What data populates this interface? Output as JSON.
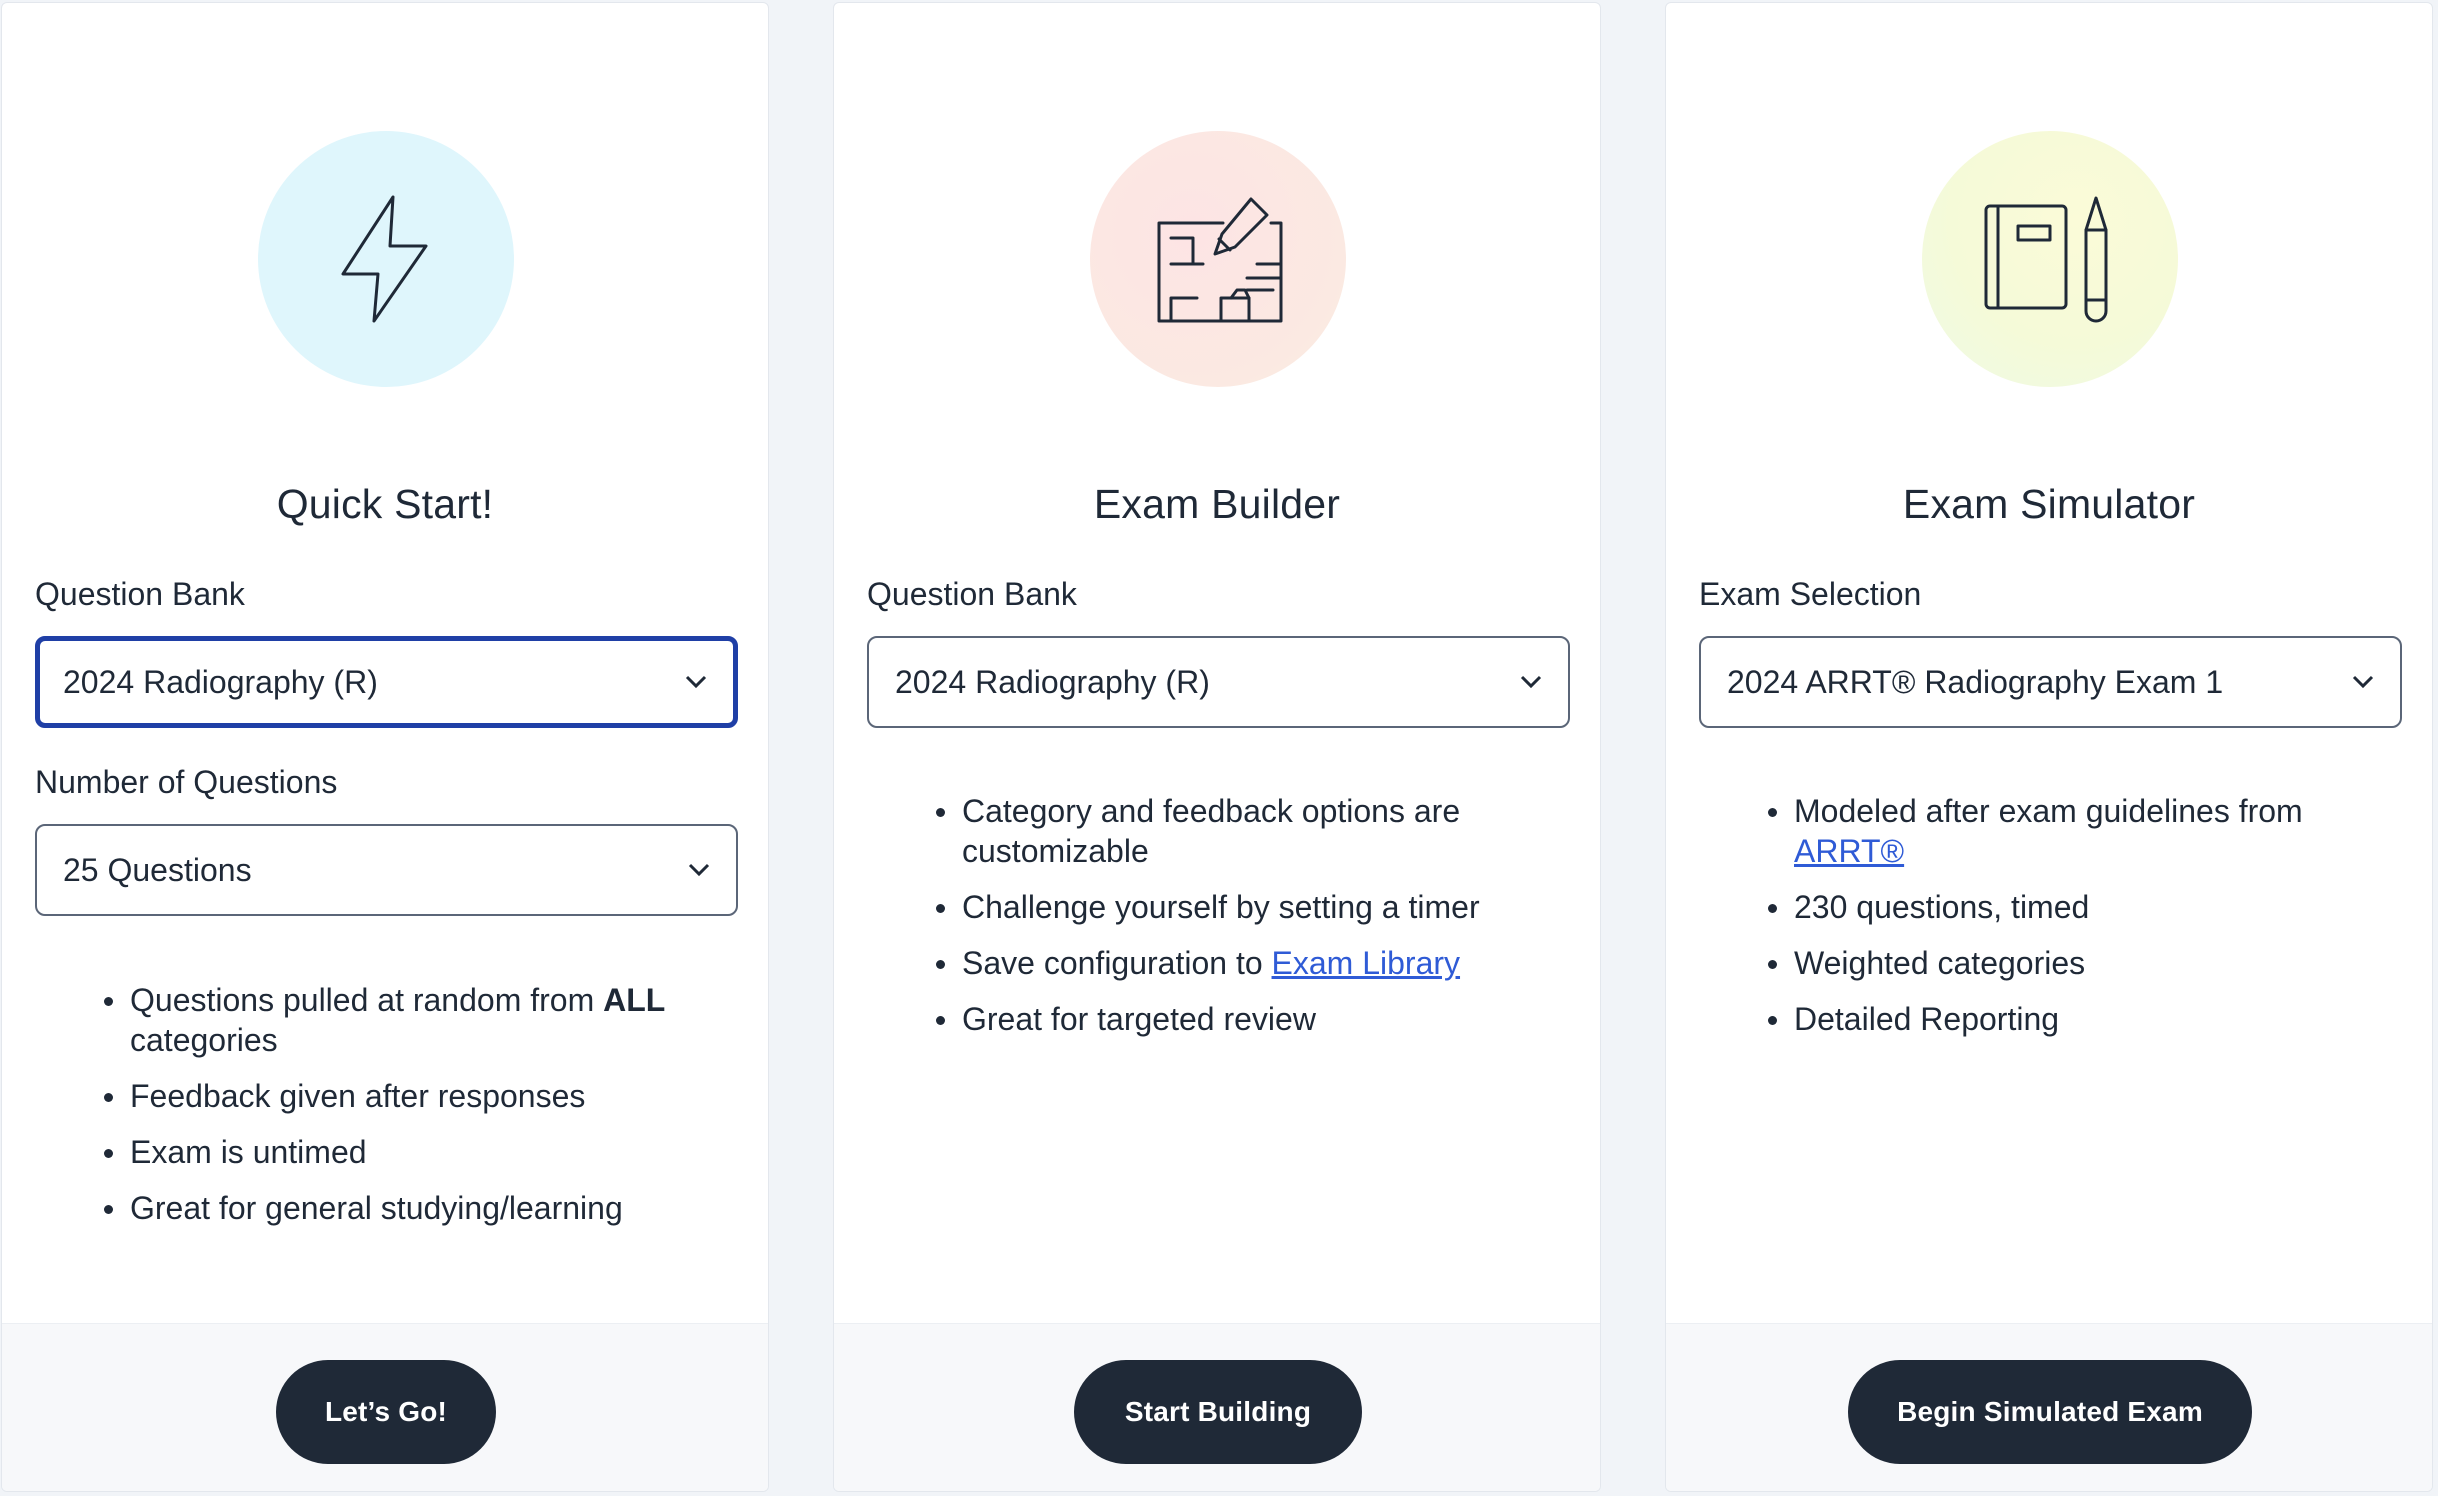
{
  "colors": {
    "page_background": "#f1f4f8",
    "button_background": "#1f2937",
    "focus_border": "#1f3fa6",
    "link": "#2f5bd6"
  },
  "quick_start": {
    "icon": "lightning-bolt-icon",
    "title": "Quick Start!",
    "bank_label": "Question Bank",
    "bank_value": "2024 Radiography (R)",
    "count_label": "Number of Questions",
    "count_value": "25 Questions",
    "features": {
      "f1_prefix": "Questions pulled at random from ",
      "f1_bold": "ALL",
      "f1_suffix": " categories",
      "f2": "Feedback given after responses",
      "f3": "Exam is untimed",
      "f4": "Great for general studying/learning"
    },
    "button": "Let’s Go!"
  },
  "exam_builder": {
    "icon": "blueprint-pencil-icon",
    "title": "Exam Builder",
    "bank_label": "Question Bank",
    "bank_value": "2024 Radiography (R)",
    "features": {
      "f1": "Category and feedback options are customizable",
      "f2": "Challenge yourself by setting a timer",
      "f3_prefix": "Save configuration to ",
      "f3_link": "Exam Library",
      "f4": "Great for targeted review"
    },
    "button": "Start Building"
  },
  "exam_simulator": {
    "icon": "notebook-pencil-icon",
    "title": "Exam Simulator",
    "selection_label": "Exam Selection",
    "selection_value": "2024 ARRT® Radiography Exam 1",
    "features": {
      "f1_prefix": "Modeled after exam guidelines from ",
      "f1_link": "ARRT®",
      "f2": "230 questions, timed",
      "f3": "Weighted categories",
      "f4": "Detailed Reporting"
    },
    "button": "Begin Simulated Exam"
  }
}
